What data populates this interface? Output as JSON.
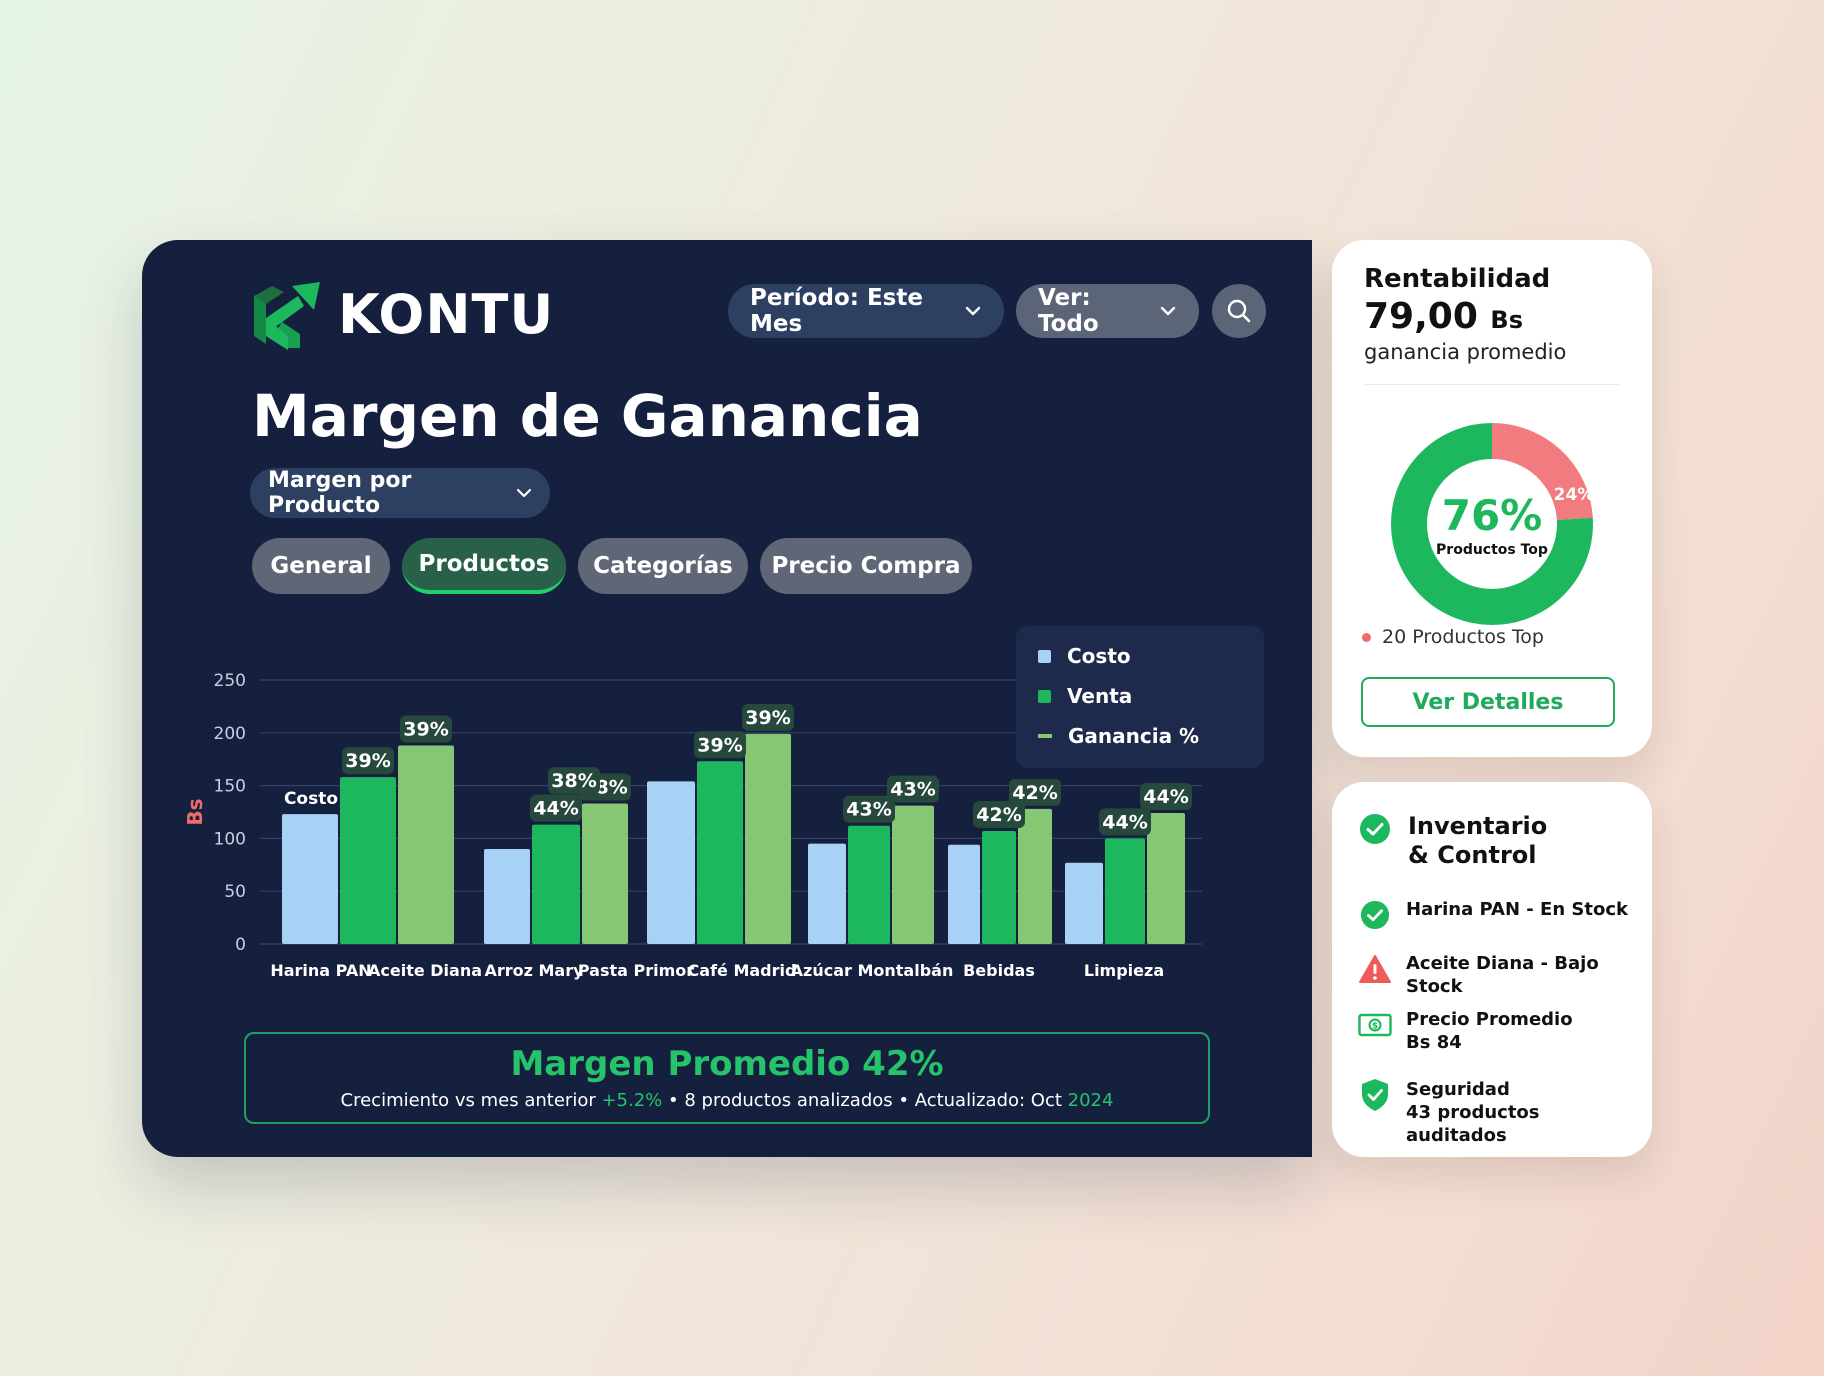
{
  "app": {
    "name": "KONTU"
  },
  "filters": {
    "periodo": "Período: Este Mes",
    "ver": "Ver: Todo"
  },
  "main": {
    "title": "Margen de Ganancia",
    "view_dropdown": "Margen por Producto",
    "tabs": [
      {
        "label": "General",
        "active": false
      },
      {
        "label": "Productos",
        "active": true
      },
      {
        "label": "Categorías",
        "active": false
      },
      {
        "label": "Precio Compra",
        "active": false
      }
    ]
  },
  "chart_data": {
    "type": "bar",
    "ylabel": "Bs",
    "ylim": [
      0,
      250
    ],
    "yticks": [
      0,
      50,
      100,
      150,
      200,
      250
    ],
    "grid": true,
    "legend_position": "top-right",
    "legend": [
      "Costo",
      "Venta",
      "Ganancia %"
    ],
    "inline_annotation": "Costo",
    "colors": {
      "costo": "#a8d2f5",
      "venta": "#1db85e",
      "ganancia": "#86c773"
    },
    "groups": [
      {
        "labels": [
          "Harina PAN",
          "Aceite Diana"
        ],
        "costo": 123,
        "venta": 158,
        "ganancia": 188,
        "venta_label": "39%",
        "ganancia_label": "39%"
      },
      {
        "labels": [
          "Arroz Mary",
          "Pasta Primor"
        ],
        "costo": 90,
        "venta": 113,
        "ganancia": 133,
        "venta_label": "44%",
        "ganancia_label": "38%",
        "extra_label": "38%"
      },
      {
        "labels": [
          "Café Madrid"
        ],
        "costo": 154,
        "venta": 173,
        "ganancia": 199,
        "venta_label": "39%",
        "ganancia_label": "39%"
      },
      {
        "labels": [
          "Azúcar Montalbán"
        ],
        "costo": 95,
        "venta": 112,
        "ganancia": 131,
        "venta_label": "43%",
        "ganancia_label": "43%"
      },
      {
        "labels": [
          "Bebidas"
        ],
        "costo": 94,
        "venta": 107,
        "ganancia": 128,
        "venta_label": "42%",
        "ganancia_label": "42%"
      },
      {
        "labels": [
          "Limpieza"
        ],
        "costo": 77,
        "venta": 100,
        "ganancia": 124,
        "venta_label": "44%",
        "ganancia_label": "44%"
      }
    ]
  },
  "summary": {
    "title": "Margen Promedio 42%",
    "prefix": "Crecimiento vs mes anterior",
    "growth": "+5.2%",
    "middle": "• 8 productos analizados • Actualizado: Oct",
    "year": "2024"
  },
  "rentabilidad": {
    "title": "Rentabilidad",
    "value": "79,00",
    "unit": "Bs",
    "subtitle": "ganancia promedio",
    "donut": {
      "main_pct": 76,
      "main_label": "76%",
      "main_caption": "Productos Top",
      "rest_label": "24%",
      "main_color": "#1db85e",
      "rest_color": "#f17b7e"
    },
    "legend": "20 Productos Top",
    "button": "Ver Detalles"
  },
  "inventario": {
    "title": "Inventario & Control",
    "items": [
      {
        "icon": "check-circle-icon",
        "line1": "Harina PAN - En Stock",
        "line2": ""
      },
      {
        "icon": "warning-icon",
        "line1": "Aceite Diana - Bajo Stock",
        "line2": ""
      },
      {
        "icon": "money-icon",
        "line1": "Precio Promedio",
        "line2": "Bs 84"
      },
      {
        "icon": "shield-icon",
        "line1": "Seguridad",
        "line2": "43 productos auditados"
      }
    ]
  }
}
